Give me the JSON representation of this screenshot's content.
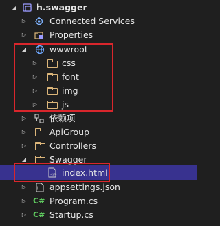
{
  "project": {
    "label": "h.swagger",
    "icon": "csharp-project-icon"
  },
  "items": [
    {
      "label": "Connected Services",
      "icon": "connected-services-icon",
      "expandable": true,
      "expanded": false
    },
    {
      "label": "Properties",
      "icon": "properties-icon",
      "expandable": true,
      "expanded": false
    },
    {
      "label": "wwwroot",
      "icon": "globe-icon",
      "expandable": true,
      "expanded": true
    },
    {
      "label": "css",
      "icon": "folder-icon",
      "expandable": true,
      "expanded": false
    },
    {
      "label": "font",
      "icon": "folder-icon",
      "expandable": true,
      "expanded": false
    },
    {
      "label": "img",
      "icon": "folder-icon",
      "expandable": true,
      "expanded": false
    },
    {
      "label": "js",
      "icon": "folder-icon",
      "expandable": true,
      "expanded": false
    },
    {
      "label": "依赖项",
      "icon": "dependencies-icon",
      "expandable": true,
      "expanded": false
    },
    {
      "label": "ApiGroup",
      "icon": "folder-icon",
      "expandable": true,
      "expanded": false
    },
    {
      "label": "Controllers",
      "icon": "folder-icon",
      "expandable": true,
      "expanded": false
    },
    {
      "label": "Swagger",
      "icon": "folder-icon",
      "expandable": true,
      "expanded": true
    },
    {
      "label": "index.html",
      "icon": "html-file-icon",
      "expandable": false,
      "selected": true
    },
    {
      "label": "appsettings.json",
      "icon": "json-file-icon",
      "expandable": true,
      "expanded": false
    },
    {
      "label": "Program.cs",
      "icon": "csharp-file-icon",
      "expandable": true,
      "expanded": false
    },
    {
      "label": "Startup.cs",
      "icon": "csharp-file-icon",
      "expandable": true,
      "expanded": false
    }
  ],
  "colors": {
    "background": "#1f1f1f",
    "selection": "#38328f",
    "highlight": "#d9262c",
    "folder": "#dcb67a",
    "text": "#e6e6e6"
  }
}
